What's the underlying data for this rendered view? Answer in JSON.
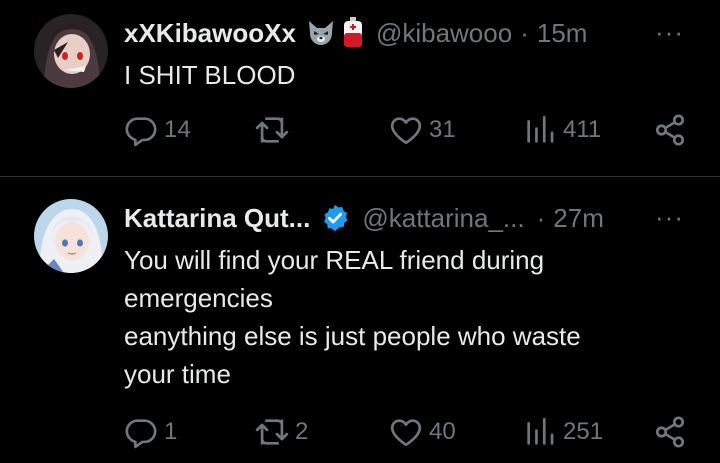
{
  "tweets": [
    {
      "display_name": "xXKibawooXx",
      "name_emoji": [
        "wolf-emoji",
        "blood-bag-emoji"
      ],
      "handle": "@kibawooo",
      "separator": "·",
      "time": "15m",
      "more": "···",
      "text_lines": [
        "I SHIT BLOOD"
      ],
      "replies": "14",
      "retweets": "",
      "likes": "31",
      "views": "411"
    },
    {
      "display_name": "Kattarina Qut...",
      "verified": true,
      "handle": "@kattarina_...",
      "separator": "·",
      "time": "27m",
      "more": "···",
      "text_lines": [
        "You will find your REAL friend during",
        "emergencies",
        "eanything else is just people who waste",
        "your time"
      ],
      "replies": "1",
      "retweets": "2",
      "likes": "40",
      "views": "251"
    }
  ],
  "colors": {
    "background": "#000000",
    "text": "#e7e9ea",
    "muted": "#71767b",
    "verified": "#1d9bf0",
    "divider": "#2f3336"
  },
  "icons": [
    "reply-icon",
    "retweet-icon",
    "like-icon",
    "views-icon",
    "share-icon",
    "verified-badge-icon",
    "more-icon"
  ]
}
